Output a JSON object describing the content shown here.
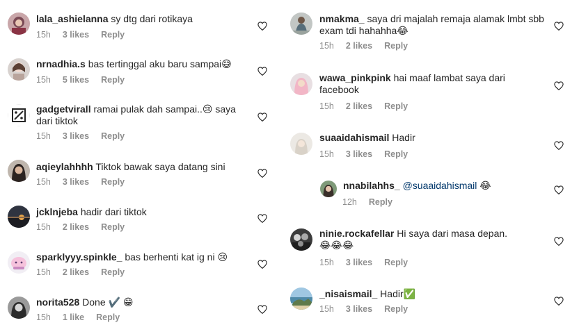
{
  "reply_label": "Reply",
  "left_comments": [
    {
      "username": "lala_ashielanna",
      "text": "sy dtg dari rotikaya",
      "time": "15h",
      "likes": "3 likes",
      "avatar": "avatar-woman-hijab"
    },
    {
      "username": "nrnadhia.s",
      "text": "bas tertinggal aku baru sampai😅",
      "time": "15h",
      "likes": "5 likes",
      "avatar": "avatar-woman-portrait"
    },
    {
      "username": "gadgetvirall",
      "text": "ramai pulak dah sampai..😢 saya dari tiktok",
      "time": "15h",
      "likes": "3 likes",
      "avatar": "avatar-percent-logo"
    },
    {
      "username": "aqieylahhhh",
      "text": "Tiktok bawak saya datang sini",
      "time": "15h",
      "likes": "3 likes",
      "avatar": "avatar-woman-dark"
    },
    {
      "username": "jcklnjeba",
      "text": "hadir dari tiktok",
      "time": "15h",
      "likes": "2 likes",
      "avatar": "avatar-sunset"
    },
    {
      "username": "sparklyyy.spinkle_",
      "text": "bas berhenti kat ig ni 😢",
      "time": "15h",
      "likes": "2 likes",
      "avatar": "avatar-pink-cartoon"
    },
    {
      "username": "norita528",
      "text": "Done ✔️ 😁",
      "time": "15h",
      "likes": "1 like",
      "avatar": "avatar-woman-bw"
    }
  ],
  "right_comments": [
    {
      "username": "nmakma_",
      "text": "saya dri majalah remaja alamak lmbt sbb exam tdi hahahha😂",
      "time": "15h",
      "likes": "2 likes",
      "avatar": "avatar-person-sitting"
    },
    {
      "username": "wawa_pinkpink",
      "text": "hai maaf lambat saya dari facebook",
      "time": "15h",
      "likes": "2 likes",
      "avatar": "avatar-pink-hijab"
    },
    {
      "username": "suaaidahismail",
      "text": "Hadir",
      "time": "15h",
      "likes": "3 likes",
      "avatar": "avatar-light-photo"
    },
    {
      "username": "nnabilahhs_",
      "mention": "@suaaidahismail",
      "text": "😂",
      "time": "12h",
      "likes": "",
      "avatar": "avatar-woman-green",
      "is_reply": true
    },
    {
      "username": "ninie.rockafellar",
      "text": "Hi saya dari masa depan. 😂😂😂",
      "time": "15h",
      "likes": "3 likes",
      "avatar": "avatar-bw-group"
    },
    {
      "username": "_nisaismail_",
      "text": "Hadir✅",
      "time": "15h",
      "likes": "3 likes",
      "avatar": "avatar-beach"
    }
  ],
  "colors": {
    "text": "#262626",
    "meta": "#8e8e8e",
    "mention": "#00376b",
    "background": "#ffffff"
  }
}
